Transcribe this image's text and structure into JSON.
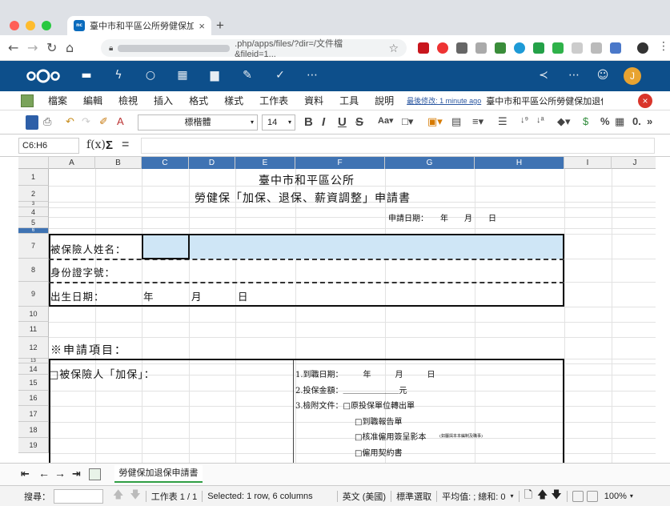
{
  "browser": {
    "tab_title": "臺中市和平區公所勞健保加退保",
    "tab_close": "×",
    "new_tab": "+",
    "url": ".php/apps/files/?dir=/文件檔&fileid=1...",
    "favicon_text": "nc"
  },
  "nextcloud": {
    "avatar_letter": "J"
  },
  "menu": {
    "items": [
      "檔案",
      "編輯",
      "檢視",
      "插入",
      "格式",
      "樣式",
      "工作表",
      "資料",
      "工具",
      "說明"
    ],
    "last_modified": "最後修改: 1 minute ago",
    "doc_title": "臺中市和平區公所勞健保加退保申請書"
  },
  "toolbar": {
    "font": "標楷體",
    "size": "14",
    "bold": "B",
    "italic": "I",
    "underline": "U",
    "strike": "S"
  },
  "formula": {
    "namebox": "C6:H6",
    "fx": "f(x)",
    "sigma": "Σ",
    "equals": "="
  },
  "columns": [
    "A",
    "B",
    "C",
    "D",
    "E",
    "F",
    "G",
    "H",
    "I",
    "J"
  ],
  "rows": [
    "1",
    "2",
    "3",
    "4",
    "5",
    "6",
    "7",
    "8",
    "9",
    "10",
    "11",
    "12",
    "13",
    "14",
    "15",
    "16",
    "17",
    "18",
    "19"
  ],
  "sheet": {
    "title": "臺中市和平區公所",
    "subtitle": "勞健保「加保、退保、薪資調整」申請書",
    "apply_date": "申請日期：　　年　　月　　日",
    "insured_name": "被保險人姓名：",
    "id_number": "身份證字號：",
    "birth": "出生日期：",
    "year": "年",
    "month": "月",
    "day": "日",
    "apply_items": "※申請項目：",
    "enroll": "□被保險人「加保」：",
    "start_date": "1.到職日期：　　　年　　　月　　　日",
    "salary": "2.投保金額：＿＿＿＿＿＿＿元",
    "attach": "3.檢附文件：□原投保單位轉出單",
    "doc2": "□到職報告單",
    "doc3": "□核准僱用簽呈影本",
    "doc3_note": "(如屬與本本編制及職事)",
    "doc4": "□僱用契約書"
  },
  "sheet_tab": "勞健保加退保申請書",
  "status": {
    "search_label": "搜尋：",
    "sheet_count": "工作表 1 / 1",
    "selected": "Selected: 1 row, 6 columns",
    "lang": "英文 (美國)",
    "mode": "標準選取",
    "stats": "平均值: ; 總和: 0",
    "zoom": "100%"
  }
}
